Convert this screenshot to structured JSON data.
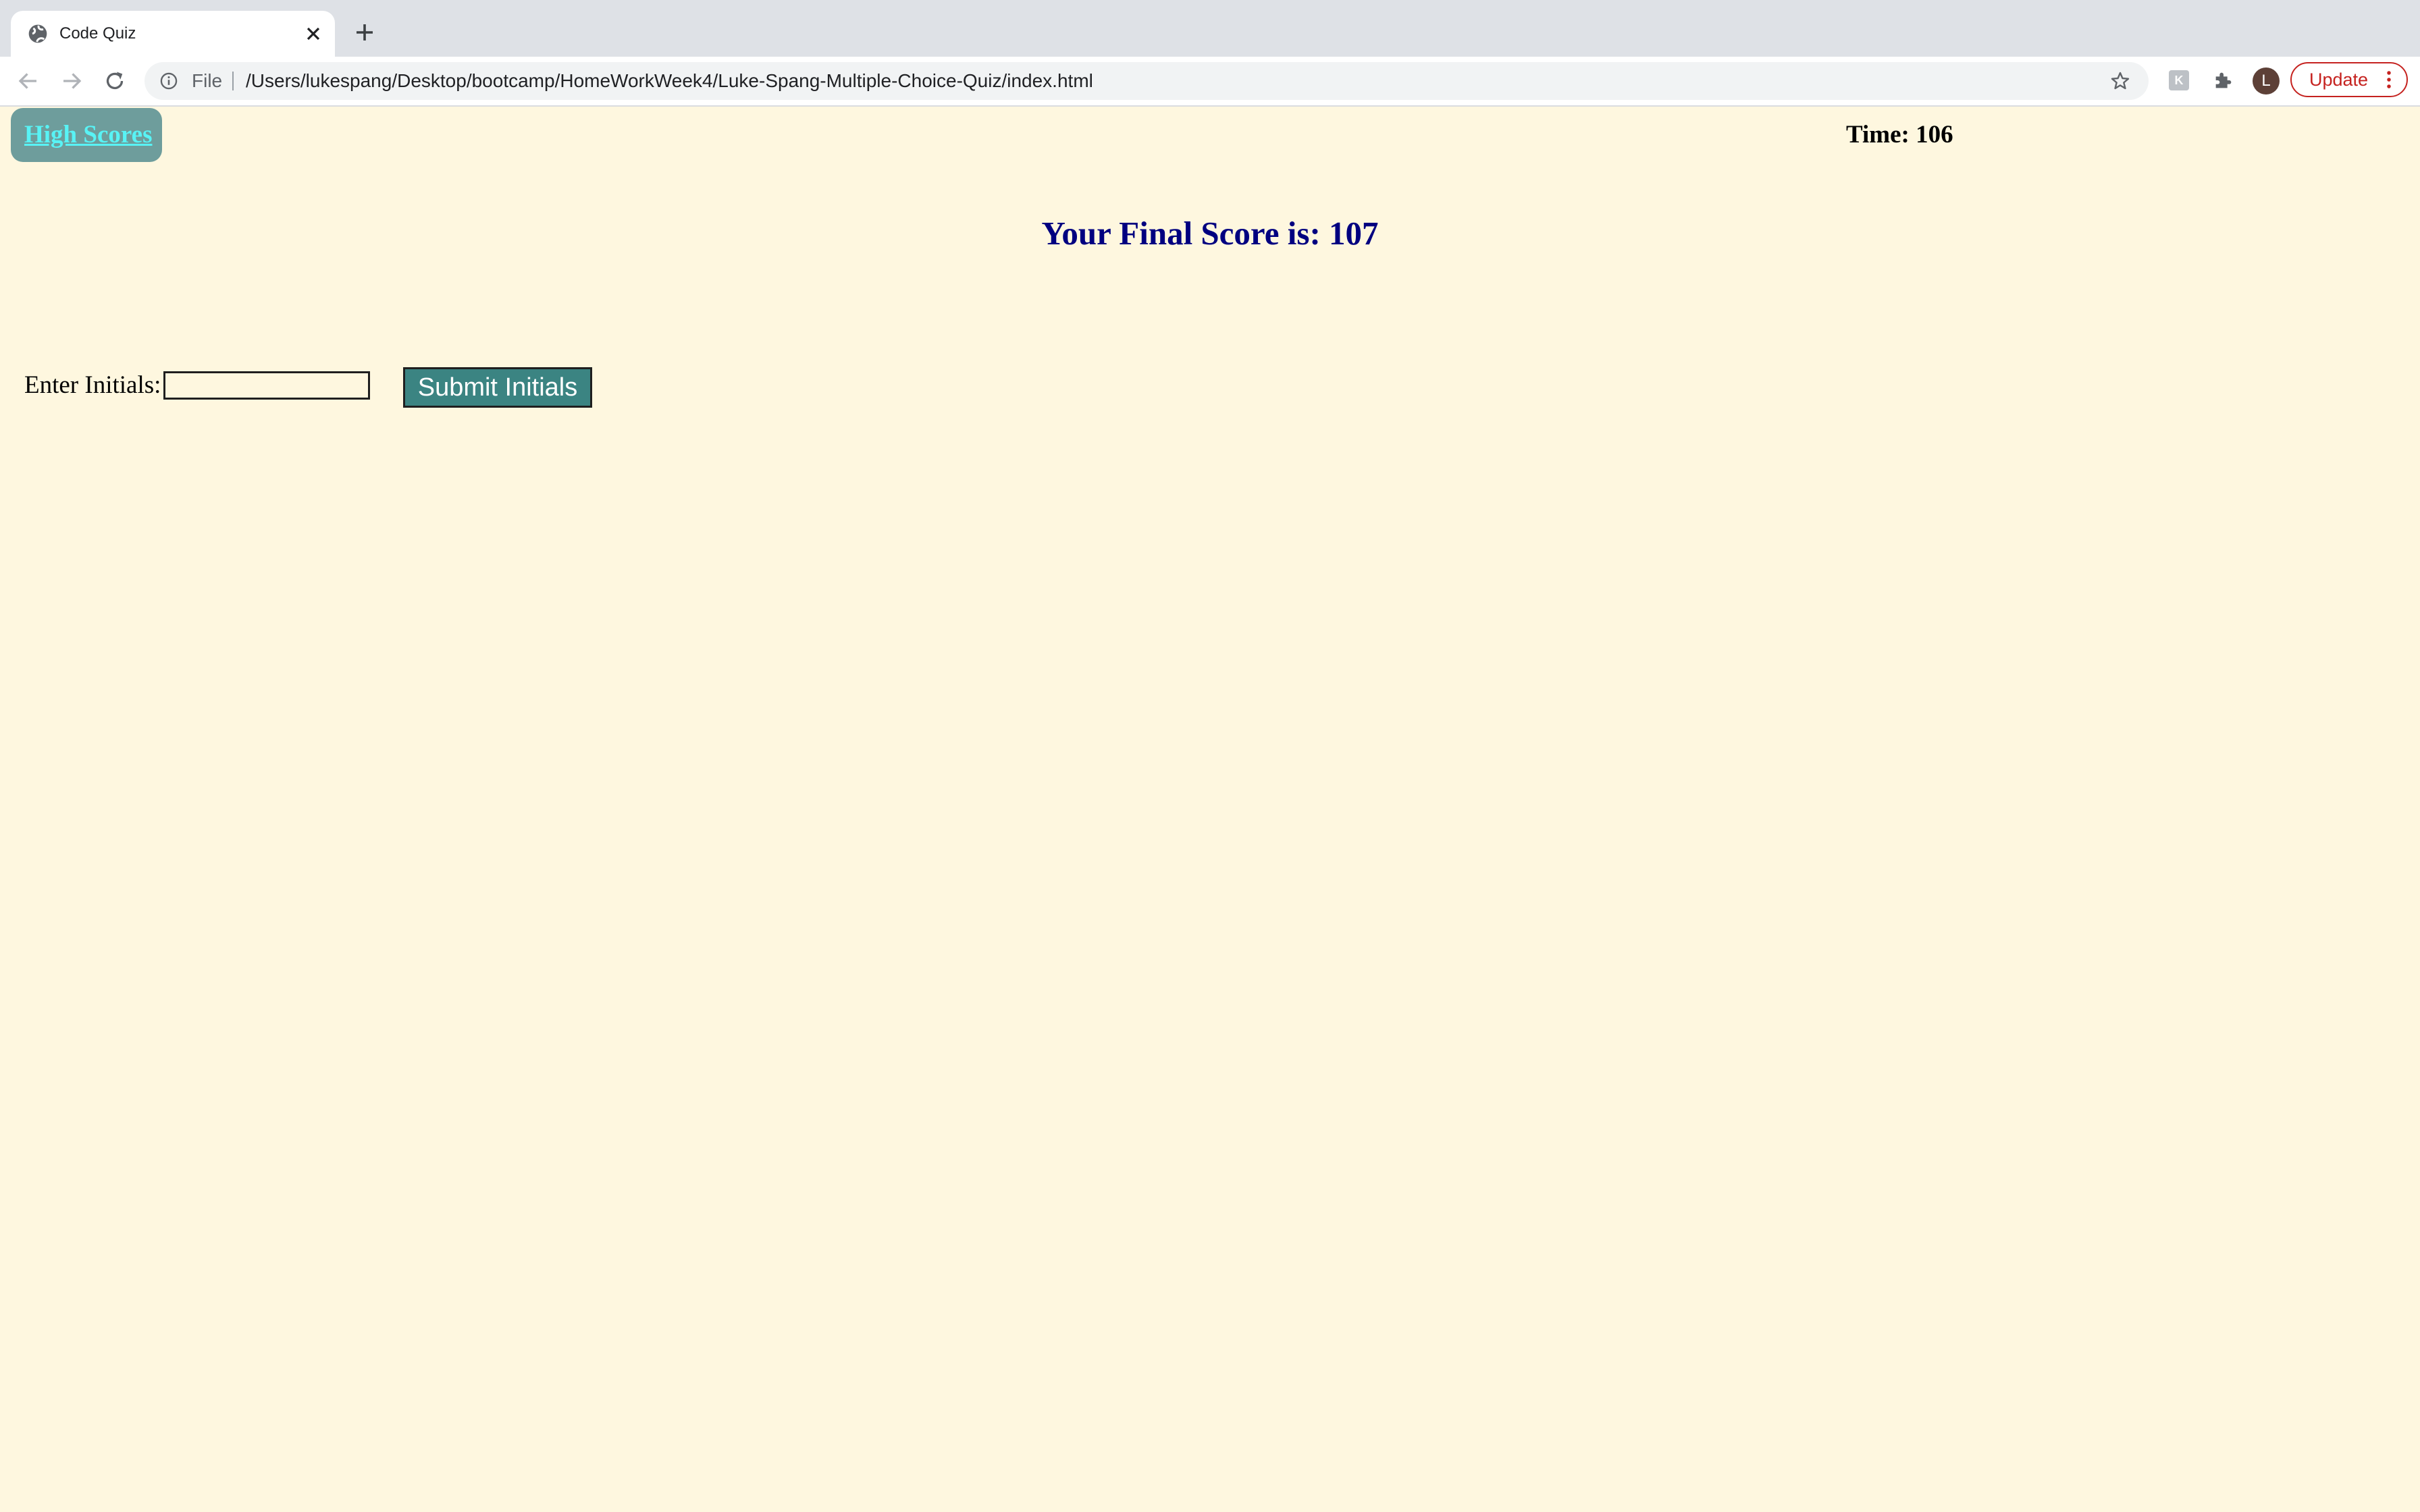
{
  "browser": {
    "tab": {
      "title": "Code Quiz",
      "icon": "globe-icon"
    },
    "omnibox": {
      "scheme": "File",
      "url": "/Users/lukespang/Desktop/bootcamp/HomeWorkWeek4/Luke-Spang-Multiple-Choice-Quiz/index.html"
    },
    "profile_initial": "L",
    "update_label": "Update"
  },
  "page": {
    "high_scores_link": "High Scores",
    "timer": "Time: 106",
    "final_score": "Your Final Score is: 107",
    "initials_label": "Enter Initials:",
    "initials_value": "",
    "submit_label": "Submit Initials"
  },
  "colors": {
    "page_background": "#fef7df",
    "heading": "#000080",
    "high_scores_bg": "#6e9d9c",
    "high_scores_link": "#58f3f5",
    "submit_bg": "#3b8482",
    "update": "#c5221f"
  }
}
